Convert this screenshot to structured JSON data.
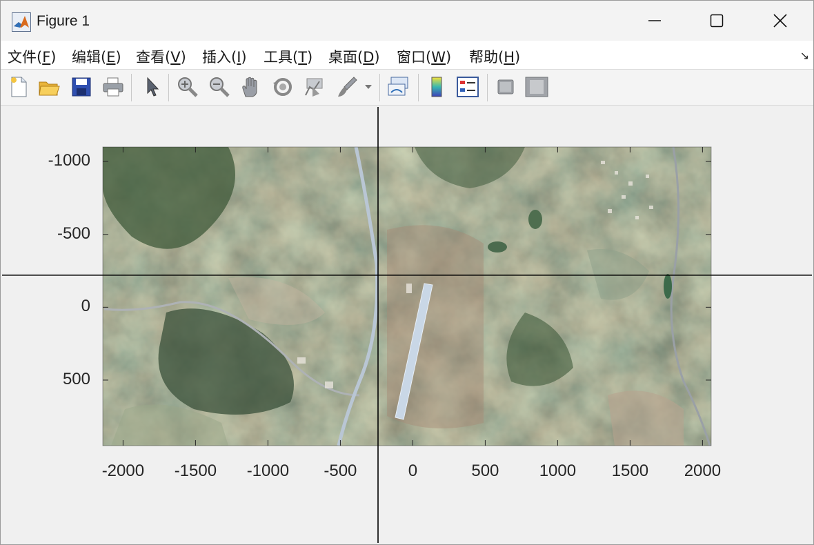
{
  "window": {
    "title": "Figure 1",
    "controls": {
      "minimize": "—",
      "maximize": "☐",
      "close": "✕"
    }
  },
  "menubar": {
    "items": [
      {
        "label": "文件(",
        "key": "F",
        "suffix": ")"
      },
      {
        "label": "编辑(",
        "key": "E",
        "suffix": ")"
      },
      {
        "label": "查看(",
        "key": "V",
        "suffix": ")"
      },
      {
        "label": "插入(",
        "key": "I",
        "suffix": ")"
      },
      {
        "label": "工具(",
        "key": "T",
        "suffix": ")"
      },
      {
        "label": "桌面(",
        "key": "D",
        "suffix": ")"
      },
      {
        "label": "窗口(",
        "key": "W",
        "suffix": ")"
      },
      {
        "label": "帮助(",
        "key": "H",
        "suffix": ")"
      }
    ],
    "overflow_icon": "↘"
  },
  "toolbar": {
    "buttons": [
      "new-figure-icon",
      "open-file-icon",
      "save-icon",
      "print-icon",
      "pointer-icon",
      "zoom-in-icon",
      "zoom-out-icon",
      "pan-hand-icon",
      "rotate-3d-icon",
      "data-cursor-icon",
      "brush-icon",
      "link-plot-icon",
      "colorbar-icon",
      "legend-icon",
      "hide-plot-tools-icon",
      "show-plot-tools-icon"
    ]
  },
  "axes": {
    "x_ticks": [
      "-2000",
      "-1500",
      "-1000",
      "-500",
      "0",
      "500",
      "1000",
      "1500",
      "2000"
    ],
    "y_ticks": [
      "-1000",
      "-500",
      "0",
      "500"
    ],
    "x_tick_values": [
      -2000,
      -1500,
      -1000,
      -500,
      0,
      500,
      1000,
      1500,
      2000
    ],
    "y_tick_values": [
      -1000,
      -500,
      0,
      500
    ],
    "xlim": [
      -2140,
      2060
    ],
    "ylim": [
      -1100,
      950
    ],
    "y_direction": "reverse",
    "crosshair": {
      "x": -240,
      "y": -220
    }
  },
  "colors": {
    "title_bg": "#f3f3f3",
    "figure_bg": "#f0f0f0",
    "crosshair": "#000000",
    "axis_text": "#262626"
  }
}
